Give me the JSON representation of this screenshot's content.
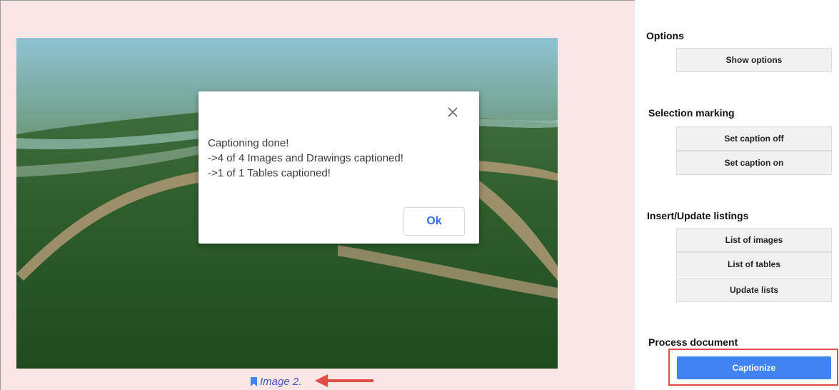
{
  "document": {
    "caption_text": "Image 2."
  },
  "dialog": {
    "message": "Captioning done!\n->4 of 4 Images and Drawings captioned!\n->1 of 1 Tables captioned!",
    "ok_label": "Ok"
  },
  "sidebar": {
    "options": {
      "title": "Options",
      "show_options_label": "Show options"
    },
    "selection_marking": {
      "title": "Selection marking",
      "caption_off_label": "Set caption off",
      "caption_on_label": "Set caption on"
    },
    "listings": {
      "title": "Insert/Update listings",
      "list_images_label": "List of images",
      "list_tables_label": "List of tables",
      "update_lists_label": "Update lists"
    },
    "process": {
      "title": "Process document",
      "captionize_label": "Captionize"
    }
  },
  "colors": {
    "doc_background": "#fbe6e6",
    "primary_button": "#3f84f0",
    "highlight_border": "#e24c44",
    "caption_text": "#3b55b8"
  },
  "icons": [
    "bookmark-icon",
    "close-icon",
    "arrow-icon"
  ]
}
